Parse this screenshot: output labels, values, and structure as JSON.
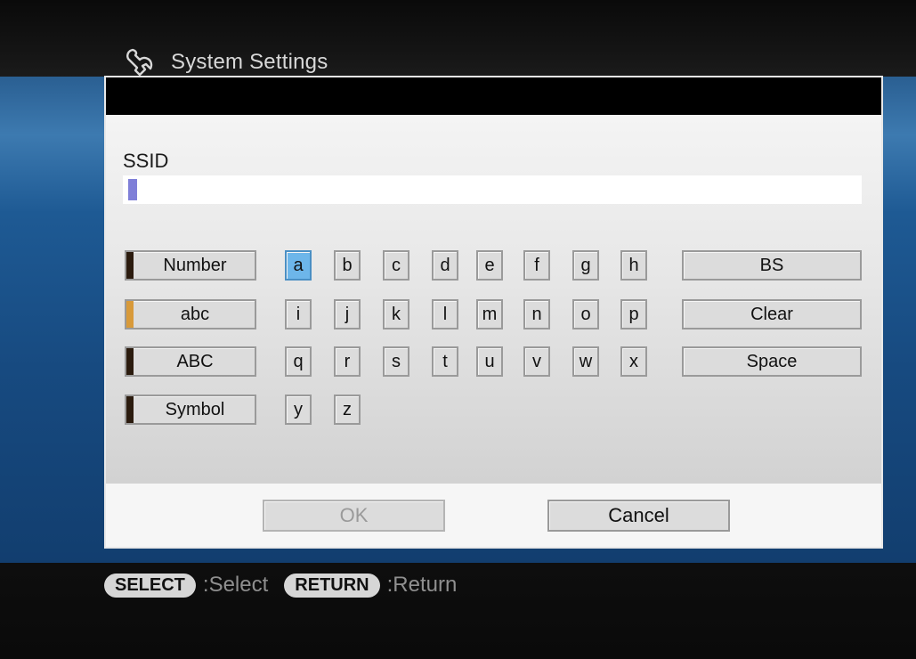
{
  "header": {
    "title": "System Settings",
    "icon": "wrench-icon"
  },
  "ssid": {
    "label": "SSID",
    "value": ""
  },
  "keyboard": {
    "modes": [
      {
        "label": "Number",
        "active": false
      },
      {
        "label": "abc",
        "active": true
      },
      {
        "label": "ABC",
        "active": false
      },
      {
        "label": "Symbol",
        "active": false
      }
    ],
    "rows": [
      [
        "a",
        "b",
        "c",
        "d",
        "e",
        "f",
        "g",
        "h"
      ],
      [
        "i",
        "j",
        "k",
        "l",
        "m",
        "n",
        "o",
        "p"
      ],
      [
        "q",
        "r",
        "s",
        "t",
        "u",
        "v",
        "w",
        "x"
      ],
      [
        "y",
        "z"
      ]
    ],
    "selected_key": "a",
    "actions": [
      "BS",
      "Clear",
      "Space"
    ]
  },
  "footer": {
    "ok_label": "OK",
    "cancel_label": "Cancel"
  },
  "hints": [
    {
      "button": "SELECT",
      "text": ":Select"
    },
    {
      "button": "RETURN",
      "text": ":Return"
    }
  ],
  "colors": {
    "selected_key": "#6db6ea",
    "active_mode_bar": "#d89a3a",
    "cursor": "#7f7fd8"
  }
}
